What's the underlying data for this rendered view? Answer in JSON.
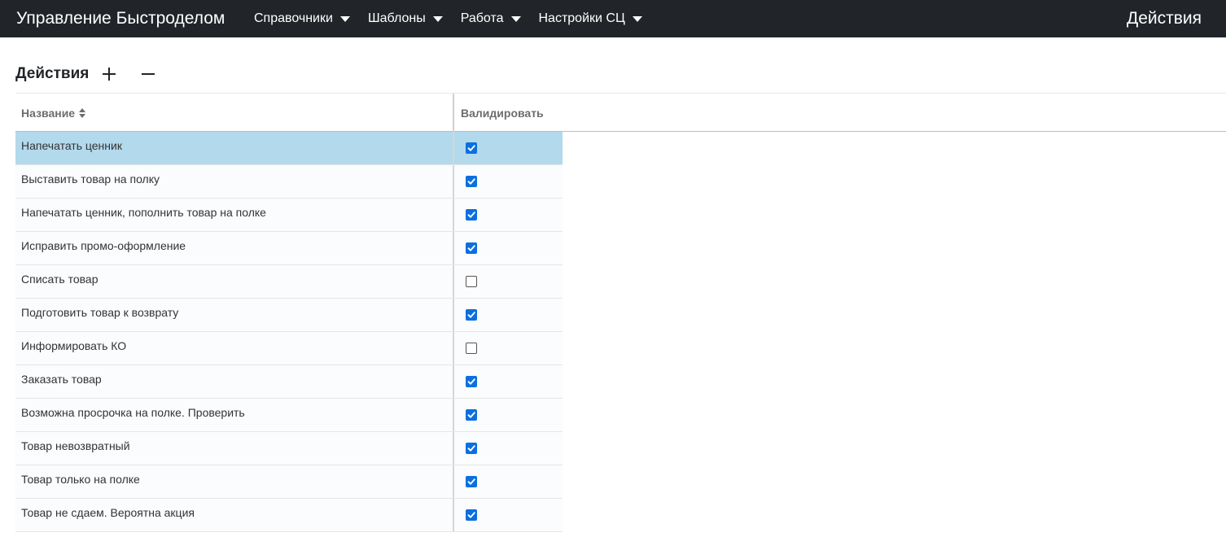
{
  "navbar": {
    "brand": "Управление Быстроделом",
    "menu": [
      {
        "label": "Справочники"
      },
      {
        "label": "Шаблоны"
      },
      {
        "label": "Работа"
      },
      {
        "label": "Настройки СЦ"
      }
    ],
    "page_label": "Действия"
  },
  "section": {
    "title": "Действия",
    "add_icon": "plus-icon",
    "remove_icon": "minus-icon"
  },
  "grid": {
    "columns": {
      "name": "Название",
      "validate": "Валидировать"
    },
    "rows": [
      {
        "name": "Напечатать ценник",
        "validate": true,
        "selected": true
      },
      {
        "name": "Выставить товар на полку",
        "validate": true
      },
      {
        "name": "Напечатать ценник, пополнить товар на полке",
        "validate": true
      },
      {
        "name": "Исправить промо-оформление",
        "validate": true
      },
      {
        "name": "Списать товар",
        "validate": false
      },
      {
        "name": "Подготовить товар к возврату",
        "validate": true
      },
      {
        "name": "Информировать КО",
        "validate": false
      },
      {
        "name": "Заказать товар",
        "validate": true
      },
      {
        "name": "Возможна просрочка на полке. Проверить",
        "validate": true
      },
      {
        "name": "Товар невозвратный",
        "validate": true
      },
      {
        "name": "Товар только на полке",
        "validate": true
      },
      {
        "name": "Товар не сдаем. Вероятна акция",
        "validate": true
      }
    ]
  },
  "colors": {
    "navbar_bg": "#212529",
    "selected_row": "#b3d9ec",
    "checkbox_checked": "#0b6fe0"
  }
}
